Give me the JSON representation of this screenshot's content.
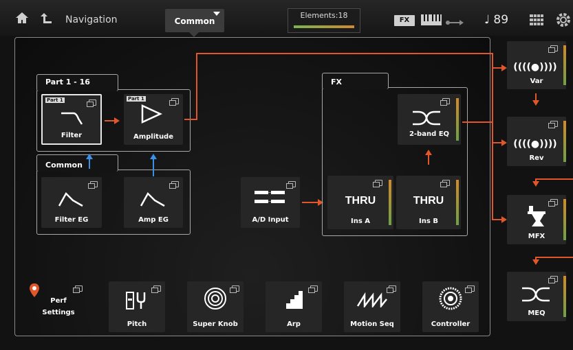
{
  "topbar": {
    "home_icon": "home-icon",
    "back_icon": "back-icon",
    "nav_label": "Navigation",
    "tab_label": "Common",
    "elements_label": "Elements:18",
    "fx_badge": "FX",
    "tempo": "♩ 89"
  },
  "part_group": {
    "title": "Part 1 - 16",
    "filter": {
      "tag": "Part 1",
      "label": "Filter"
    },
    "amplitude": {
      "tag": "Part 1",
      "label": "Amplitude"
    }
  },
  "common_group": {
    "title": "Common",
    "filter_eg": "Filter EG",
    "amp_eg": "Amp EG"
  },
  "ad_input": "A/D Input",
  "fx_group": {
    "title": "FX",
    "eq": "2-band EQ",
    "ins_a": {
      "value": "THRU",
      "label": "Ins A"
    },
    "ins_b": {
      "value": "THRU",
      "label": "Ins B"
    }
  },
  "right_chain": {
    "var": "Var",
    "rev": "Rev",
    "mfx": "MFX",
    "meq": "MEQ"
  },
  "bottom_row": {
    "perf_settings": "Perf\nSettings",
    "pitch": "Pitch",
    "super_knob": "Super Knob",
    "arp": "Arp",
    "motion_seq": "Motion Seq",
    "controller": "Controller"
  },
  "colors": {
    "flow_line": "#e2572a",
    "control_line": "#3b90e8",
    "meter_green": "#6fa145",
    "meter_orange": "#d48a28"
  }
}
